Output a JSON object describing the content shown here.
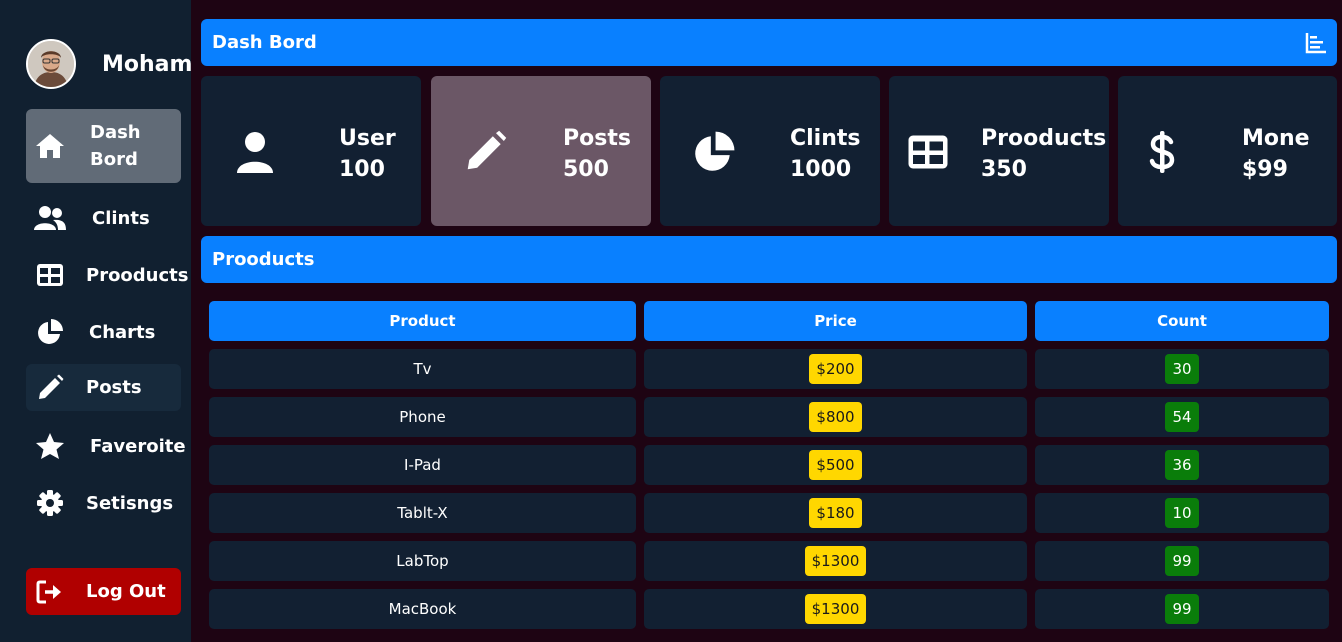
{
  "sidebar": {
    "user_name": "Mohamed",
    "items": [
      {
        "label": "Dash Bord",
        "icon": "home-icon"
      },
      {
        "label": "Clints",
        "icon": "users-icon"
      },
      {
        "label": "Prooducts",
        "icon": "table-icon"
      },
      {
        "label": "Charts",
        "icon": "pie-chart-icon"
      },
      {
        "label": "Posts",
        "icon": "pencil-icon"
      },
      {
        "label": "Faveroite",
        "icon": "star-icon"
      },
      {
        "label": "Setisngs",
        "icon": "gear-icon"
      }
    ],
    "logout_label": "Log Out"
  },
  "header": {
    "title": "Dash Bord",
    "icon": "bar-chart-icon"
  },
  "cards": [
    {
      "label": "User",
      "value": "100",
      "icon": "user-icon"
    },
    {
      "label": "Posts",
      "value": "500",
      "icon": "pencil-icon"
    },
    {
      "label": "Clints",
      "value": "1000",
      "icon": "pie-chart-icon"
    },
    {
      "label": "Prooducts",
      "value": "350",
      "icon": "table-icon"
    },
    {
      "label": "Mone",
      "value": "$99",
      "icon": "dollar-icon"
    }
  ],
  "products_section": {
    "title": "Prooducts"
  },
  "table": {
    "columns": [
      "Product",
      "Price",
      "Count"
    ],
    "rows": [
      {
        "product": "Tv",
        "price": "$200",
        "count": "30"
      },
      {
        "product": "Phone",
        "price": "$800",
        "count": "54"
      },
      {
        "product": "I-Pad",
        "price": "$500",
        "count": "36"
      },
      {
        "product": "Tablt-X",
        "price": "$180",
        "count": "10"
      },
      {
        "product": "LabTop",
        "price": "$1300",
        "count": "99"
      },
      {
        "product": "MacBook",
        "price": "$1300",
        "count": "99"
      }
    ]
  },
  "colors": {
    "accent": "#0980ff",
    "sidebar_bg": "#112030",
    "page_bg": "#1e0413",
    "logout": "#b00000",
    "price_badge": "#ffd700",
    "count_badge": "#0a7d0a"
  }
}
